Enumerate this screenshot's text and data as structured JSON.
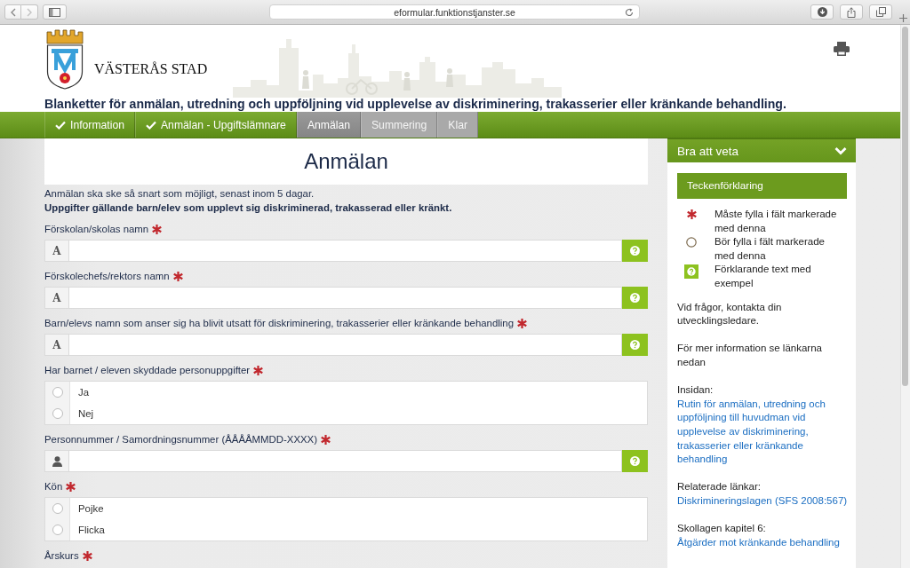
{
  "browser": {
    "url": "eformular.funktionstjanster.se"
  },
  "header": {
    "org_name": "VÄSTERÅS STAD",
    "title": "Blanketter för anmälan, utredning och uppföljning vid upplevelse av diskriminering, trakasserier eller kränkande behandling."
  },
  "steps": [
    {
      "label": "Information",
      "completed": true,
      "selected": false
    },
    {
      "label": "Anmälan - Upgiftslämnare",
      "completed": true,
      "selected": false
    },
    {
      "label": "Anmälan",
      "completed": false,
      "selected": true
    },
    {
      "label": "Summering",
      "completed": false,
      "selected": false
    },
    {
      "label": "Klar",
      "completed": false,
      "selected": false
    }
  ],
  "form": {
    "title": "Anmälan",
    "intro": "Anmälan ska ske så snart som möjligt, senast inom 5 dagar.",
    "section_heading": "Uppgifter gällande barn/elev som upplevt sig diskriminerad, trakasserad eller kränkt.",
    "fields": [
      {
        "kind": "text",
        "label": "Förskolan/skolas namn",
        "required": true,
        "prefix": "A",
        "help": true
      },
      {
        "kind": "text",
        "label": "Förskolechefs/rektors namn",
        "required": true,
        "prefix": "A",
        "help": true
      },
      {
        "kind": "text",
        "label": "Barn/elevs namn som anser sig ha blivit utsatt för diskriminering, trakasserier eller kränkande behandling",
        "required": true,
        "prefix": "A",
        "help": true
      },
      {
        "kind": "radio",
        "label": "Har barnet / eleven skyddade personuppgifter",
        "required": true,
        "options": [
          {
            "label": "Ja",
            "selected": false
          },
          {
            "label": "Nej",
            "selected": false
          }
        ]
      },
      {
        "kind": "person",
        "label": "Personnummer / Samordningsnummer (ÅÅÅÅMMDD-XXXX)",
        "required": true,
        "help": true
      },
      {
        "kind": "radio",
        "label": "Kön",
        "required": true,
        "options": [
          {
            "label": "Pojke",
            "selected": false
          },
          {
            "label": "Flicka",
            "selected": false
          }
        ]
      },
      {
        "label": "Årskurs",
        "required": true
      }
    ]
  },
  "sidebar": {
    "title": "Bra att veta",
    "expanded": true,
    "legend_title": "Teckenförklaring",
    "legend": [
      {
        "kind": "required",
        "text": "Måste fylla i fält markerade med denna"
      },
      {
        "kind": "recommended",
        "text": "Bör fylla i fält markerade med denna"
      },
      {
        "kind": "help",
        "text": "Förklarande text med exempel"
      }
    ],
    "notes": [
      "Vid frågor, kontakta din utvecklingsledare.",
      "För mer information se länkarna nedan"
    ],
    "link_groups": [
      {
        "heading": "Insidan:",
        "link": "Rutin för anmälan, utredning och uppföljning till huvudman vid upplevelse av diskriminering, trakasserier eller kränkande behandling"
      },
      {
        "heading": "Relaterade länkar:",
        "link": "Diskrimineringslagen (SFS 2008:567)"
      },
      {
        "heading": "Skollagen kapitel 6:",
        "link": "Åtgärder mot kränkande behandling"
      }
    ]
  }
}
